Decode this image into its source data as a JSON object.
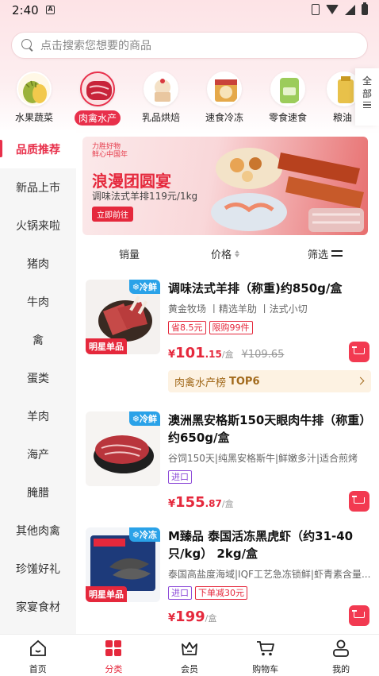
{
  "status_bar": {
    "time": "2:40",
    "a_icon": "A"
  },
  "search": {
    "placeholder": "点击搜索您想要的商品"
  },
  "categories": [
    {
      "label": "水果蔬菜",
      "icon": "durian"
    },
    {
      "label": "肉禽水产",
      "icon": "steak",
      "active": true
    },
    {
      "label": "乳品烘焙",
      "icon": "dessert"
    },
    {
      "label": "速食冷冻",
      "icon": "frozen-food"
    },
    {
      "label": "零食速食",
      "icon": "snack-bag"
    },
    {
      "label": "粮油",
      "icon": "grain-oil"
    }
  ],
  "all_categories_label": "全部",
  "sidebar": {
    "items": [
      {
        "label": "品质推荐",
        "active": true
      },
      {
        "label": "新品上市"
      },
      {
        "label": "火锅来啦"
      },
      {
        "label": "猪肉"
      },
      {
        "label": "牛肉"
      },
      {
        "label": "禽"
      },
      {
        "label": "蛋类"
      },
      {
        "label": "羊肉"
      },
      {
        "label": "海产"
      },
      {
        "label": "腌腊"
      },
      {
        "label": "其他肉禽"
      },
      {
        "label": "珍馐好礼"
      },
      {
        "label": "家宴食材"
      }
    ]
  },
  "banner": {
    "logo_line1": "力胜好物",
    "logo_line2": "鲜心中国年",
    "title": "浪漫团圆宴",
    "subtitle": "调味法式羊排119元/1kg",
    "button": "立即前往"
  },
  "filters": {
    "sales": "销量",
    "price": "价格",
    "filter": "筛选"
  },
  "products": [
    {
      "tag": "冷鲜",
      "star_tag": "明星单品",
      "title": "调味法式羊排（称重)约850g/盒",
      "desc": "黄金牧场 丨精选羊肋 丨法式小切",
      "badges": [
        "省8.5元",
        "限购99件"
      ],
      "price_cur": "¥",
      "price_int": "101",
      "price_dec": ".15",
      "unit": "/盒",
      "orig_price": "¥109.65",
      "rank_prefix": "肉禽水产榜",
      "rank_value": "TOP6"
    },
    {
      "tag": "冷鲜",
      "title": "澳洲黑安格斯150天眼肉牛排（称重）约650g/盒",
      "desc": "谷饲150天|纯黑安格斯牛|鲜嫩多汁|适合煎烤",
      "badges": [
        "进口"
      ],
      "price_cur": "¥",
      "price_int": "155",
      "price_dec": ".87",
      "unit": "/盒"
    },
    {
      "tag": "冷冻",
      "star_tag": "明星单品",
      "title": "M臻品 泰国活冻黑虎虾（约31-40只/kg） 2kg/盒",
      "desc": "泰国高盐度海域|IQF工艺急冻锁鲜|虾青素含量...",
      "badges": [
        "进口",
        "下单减30元"
      ],
      "price_cur": "¥",
      "price_int": "199",
      "price_dec": "",
      "unit": "/盒"
    }
  ],
  "bottom_nav": [
    {
      "label": "首页",
      "icon": "home-icon"
    },
    {
      "label": "分类",
      "icon": "category-icon",
      "active": true
    },
    {
      "label": "会员",
      "icon": "crown-icon"
    },
    {
      "label": "购物车",
      "icon": "cart-icon"
    },
    {
      "label": "我的",
      "icon": "profile-icon"
    }
  ],
  "colors": {
    "accent": "#e5283c",
    "tag_blue": "#2aa2e8",
    "rank_bg": "#fdf2e2"
  }
}
